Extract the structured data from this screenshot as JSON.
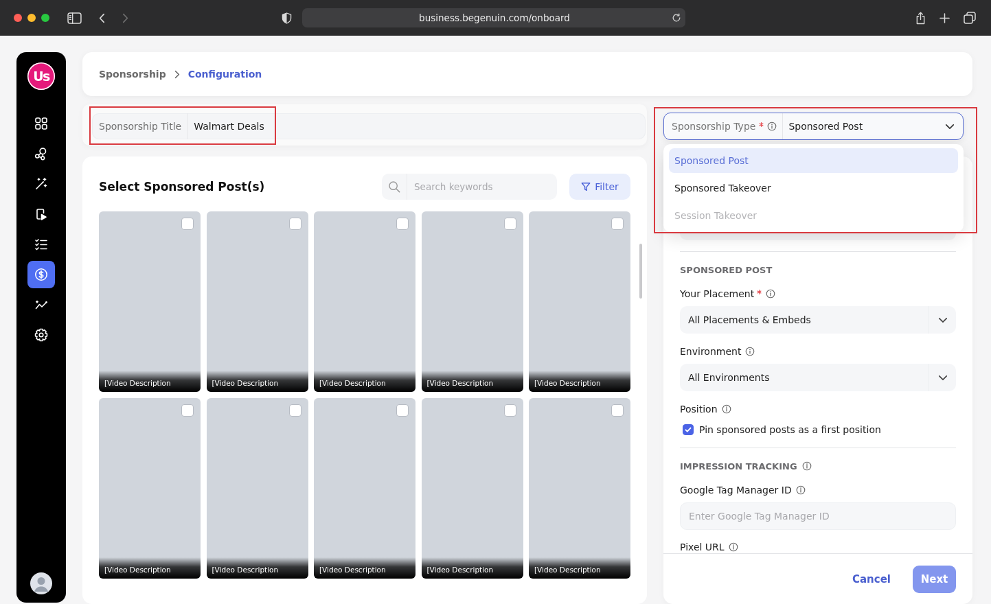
{
  "browser": {
    "url": "business.begenuin.com/onboard",
    "nav": [
      {
        "kind": "back",
        "disabled": false
      },
      {
        "kind": "forward",
        "disabled": true
      }
    ]
  },
  "sidebar": {
    "logo": "Us",
    "items": [
      {
        "selected": false
      },
      {
        "selected": false
      },
      {
        "selected": false
      },
      {
        "selected": false
      },
      {
        "selected": false
      },
      {
        "selected": true
      },
      {
        "selected": false
      },
      {
        "selected": false
      }
    ]
  },
  "breadcrumb": [
    {
      "label": "Sponsorship",
      "current": false
    },
    {
      "label": "Configuration",
      "current": true
    }
  ],
  "title_field": {
    "label": "Sponsorship Title",
    "value": "Walmart Deals",
    "highlighted": true
  },
  "posts_panel": {
    "heading": "Select Sponsored Post(s)",
    "search": {
      "placeholder": "Search keywords"
    },
    "filter_button": "Filter",
    "posts": [
      {
        "description": "[Video Description",
        "checked": false
      },
      {
        "description": "[Video Description",
        "checked": false
      },
      {
        "description": "[Video Description",
        "checked": false
      },
      {
        "description": "[Video Description",
        "checked": false
      },
      {
        "description": "[Video Description",
        "checked": false
      },
      {
        "description": "[Video Description",
        "checked": false
      },
      {
        "description": "[Video Description",
        "checked": false
      },
      {
        "description": "[Video Description",
        "checked": false
      },
      {
        "description": "[Video Description",
        "checked": false
      },
      {
        "description": "[Video Description",
        "checked": false
      }
    ]
  },
  "sponsorship_type": {
    "label": "Sponsorship Type",
    "required": true,
    "value": "Sponsored Post",
    "expanded": true,
    "highlighted": true,
    "options": [
      {
        "label": "Sponsored Post",
        "selected": true,
        "disabled": false
      },
      {
        "label": "Sponsored Takeover",
        "selected": false,
        "disabled": false
      },
      {
        "label": "Session Takeover",
        "selected": false,
        "disabled": true
      }
    ]
  },
  "settings": {
    "sections": [
      {
        "heading": "SPONSORED POST",
        "info": false,
        "fields": [
          {
            "kind": "select",
            "label": "Your Placement",
            "required": true,
            "value": "All Placements & Embeds"
          },
          {
            "kind": "select",
            "label": "Environment",
            "required": false,
            "value": "All Environments"
          },
          {
            "kind": "checkbox",
            "label": "Position",
            "required": false,
            "option": "Pin sponsored posts as a first position",
            "checked": true
          }
        ]
      },
      {
        "heading": "IMPRESSION TRACKING",
        "info": true,
        "fields": [
          {
            "kind": "input",
            "label": "Google Tag Manager ID",
            "required": false,
            "placeholder": "Enter Google Tag Manager ID"
          },
          {
            "kind": "label",
            "label": "Pixel URL",
            "required": false
          }
        ]
      }
    ]
  },
  "footer": {
    "cancel": "Cancel",
    "next": {
      "label": "Next",
      "disabled": true
    }
  }
}
